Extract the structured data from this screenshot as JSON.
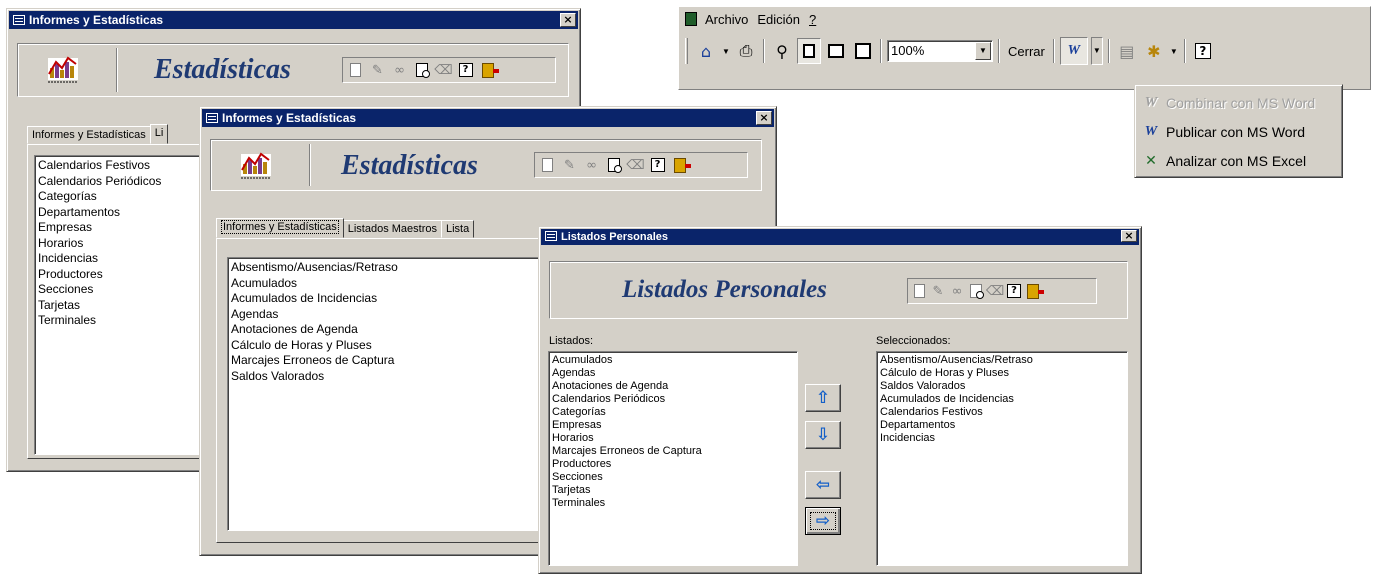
{
  "win1": {
    "title": "Informes y Estadísticas",
    "header_title": "Estadísticas",
    "tabs": [
      "Informes y Estadísticas",
      "Li"
    ],
    "items": [
      "Calendarios Festivos",
      "Calendarios Periódicos",
      "Categorías",
      "Departamentos",
      "Empresas",
      "Horarios",
      "Incidencias",
      "Productores",
      "Secciones",
      "Tarjetas",
      "Terminales"
    ]
  },
  "win2": {
    "title": "Informes y Estadísticas",
    "header_title": "Estadísticas",
    "tabs": [
      "Informes y Estadísticas",
      "Listados Maestros",
      "Lista"
    ],
    "items": [
      "Absentismo/Ausencias/Retraso",
      "Acumulados",
      "Acumulados de Incidencias",
      "Agendas",
      "Anotaciones de Agenda",
      "Cálculo de Horas y Pluses",
      "Marcajes Erroneos de Captura",
      "Saldos Valorados"
    ]
  },
  "win3": {
    "title": "Listados Personales",
    "header_title": "Listados Personales",
    "left_label": "Listados:",
    "right_label": "Seleccionados:",
    "left_items": [
      "Acumulados",
      "Agendas",
      "Anotaciones de Agenda",
      "Calendarios Periódicos",
      "Categorías",
      "Empresas",
      "Horarios",
      "Marcajes Erroneos de Captura",
      "Productores",
      "Secciones",
      "Tarjetas",
      "Terminales"
    ],
    "right_items": [
      "Absentismo/Ausencias/Retraso",
      "Cálculo de Horas y Pluses",
      "Saldos Valorados",
      "Acumulados de Incidencias",
      "Calendarios Festivos",
      "Departamentos",
      "Incidencias"
    ],
    "buttons": {
      "up": "⇧",
      "down": "⇩",
      "left": "⇦",
      "right": "⇨"
    }
  },
  "print_preview": {
    "menu": [
      "Archivo",
      "Edición",
      "?"
    ],
    "zoom": "100%",
    "close_label": "Cerrar",
    "popup": [
      "Combinar con MS Word",
      "Publicar con MS Word",
      "Analizar con MS Excel"
    ]
  },
  "colors": {
    "titlebar": "#0a246a",
    "face": "#d4d0c8",
    "header_text": "#1f3a73"
  }
}
